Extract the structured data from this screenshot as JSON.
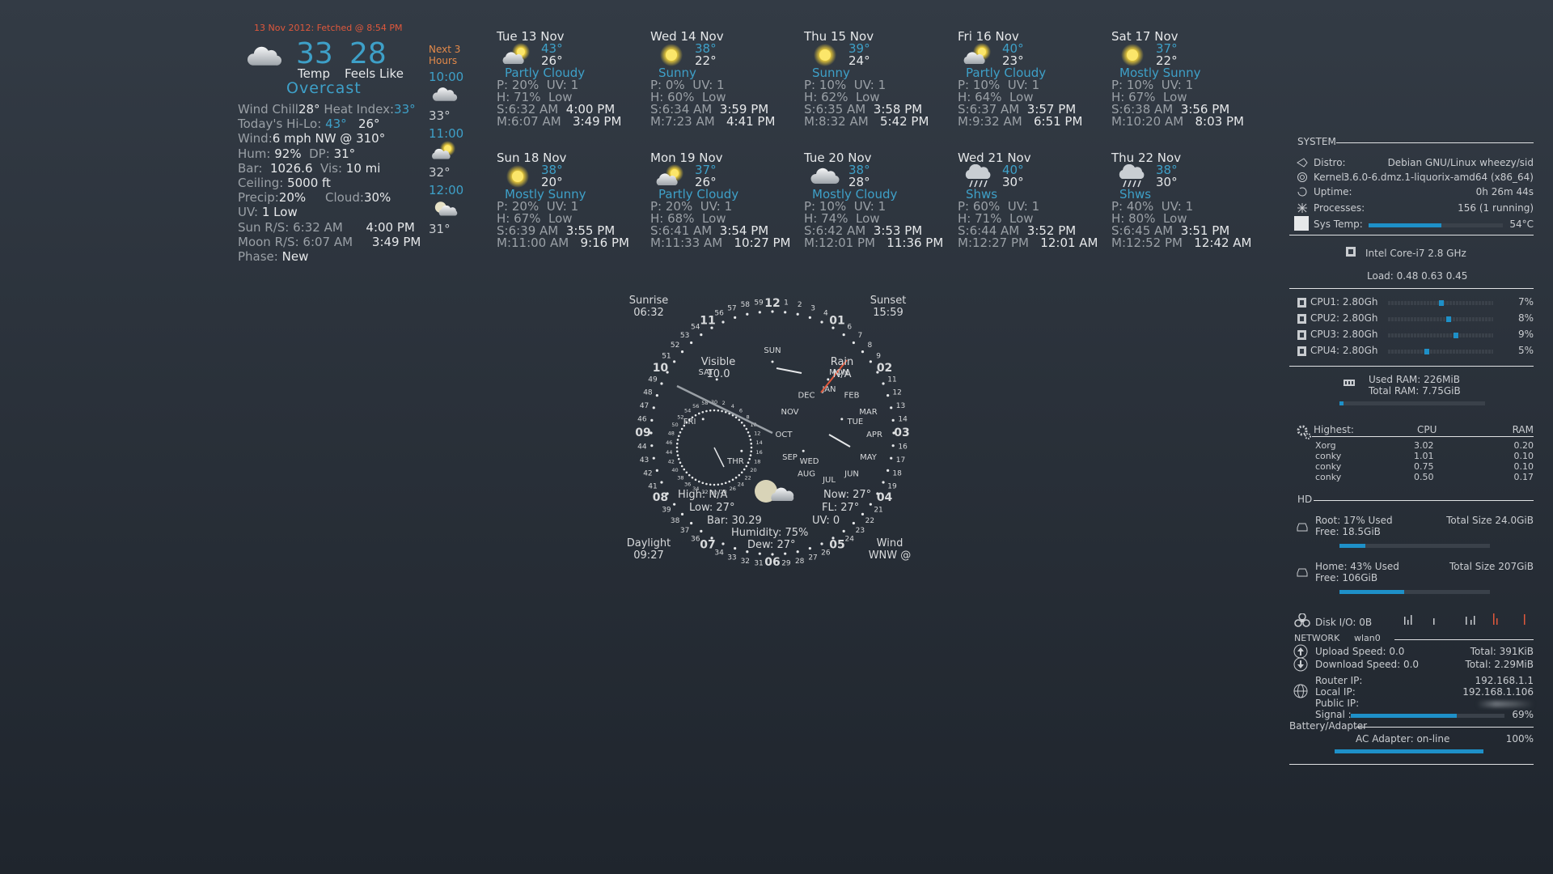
{
  "current": {
    "fetched": "13 Nov 2012: Fetched @ 8:54 PM",
    "temp": "33",
    "feels_like": "28",
    "temp_label": "Temp",
    "feels_label": "Feels Like",
    "condition": "Overcast",
    "wind_chill_label": "Wind Chill",
    "wind_chill": "28°",
    "heat_index_label": "Heat Index:",
    "heat_index": "33°",
    "hilo_label": "Today's Hi-Lo:",
    "hi": "43°",
    "lo": "26°",
    "wind_label": "Wind:",
    "wind": "6 mph   NW   @ 310°",
    "hum_label": "Hum:",
    "hum": "92%",
    "dp_label": "DP:",
    "dp": "31°",
    "bar_label": "Bar:",
    "bar": "1026.6",
    "vis_label": "Vis:",
    "vis": "10 mi",
    "ceiling_label": "Ceiling:",
    "ceiling": "5000 ft",
    "precip_label": "Precip:",
    "precip": "20%",
    "cloud_label": "Cloud:",
    "cloud": "30%",
    "uv_label": "UV:",
    "uv": "1   Low",
    "sun_label": "Sun R/S:",
    "sun_rise": "6:32 AM",
    "sun_set": "4:00 PM",
    "moon_label": "Moon R/S:",
    "moon_rise": "6:07 AM",
    "moon_set": "3:49 PM",
    "phase_label": "Phase:",
    "phase": "New"
  },
  "hourly": {
    "heading_1": "Next 3",
    "heading_2": "Hours",
    "items": [
      {
        "time": "10:00",
        "temp": "33°",
        "icon": "cloud-icon"
      },
      {
        "time": "11:00",
        "temp": "32°",
        "icon": "partly-cloudy-icon"
      },
      {
        "time": "12:00",
        "temp": "31°",
        "icon": "moon-cloud-icon"
      }
    ]
  },
  "forecast": [
    {
      "date": "Tue  13  Nov",
      "hi": "43°",
      "lo": "26°",
      "cond": "Partly Cloudy",
      "icon": "partly-cloudy-icon",
      "p": "P: 20%",
      "uv": "UV: 1",
      "h": "H: 71%",
      "uvl": "Low",
      "s": "S:6:32 AM",
      "sset": "4:00 PM",
      "m": "M:6:07 AM",
      "mset": "3:49 PM"
    },
    {
      "date": "Wed  14  Nov",
      "hi": "38°",
      "lo": "22°",
      "cond": "Sunny",
      "icon": "sun-icon",
      "p": "P: 0%",
      "uv": "UV: 1",
      "h": "H: 60%",
      "uvl": "Low",
      "s": "S:6:34 AM",
      "sset": "3:59 PM",
      "m": "M:7:23 AM",
      "mset": "4:41 PM"
    },
    {
      "date": "Thu  15  Nov",
      "hi": "39°",
      "lo": "24°",
      "cond": "Sunny",
      "icon": "sun-icon",
      "p": "P: 10%",
      "uv": "UV: 1",
      "h": "H: 62%",
      "uvl": "Low",
      "s": "S:6:35 AM",
      "sset": "3:58 PM",
      "m": "M:8:32 AM",
      "mset": "5:42 PM"
    },
    {
      "date": "Fri  16  Nov",
      "hi": "40°",
      "lo": "23°",
      "cond": "Partly Cloudy",
      "icon": "partly-cloudy-icon",
      "p": "P: 10%",
      "uv": "UV: 1",
      "h": "H: 64%",
      "uvl": "Low",
      "s": "S:6:37 AM",
      "sset": "3:57 PM",
      "m": "M:9:32 AM",
      "mset": "6:51 PM"
    },
    {
      "date": "Sat  17  Nov",
      "hi": "37°",
      "lo": "22°",
      "cond": "Mostly Sunny",
      "icon": "sun-icon",
      "p": "P: 10%",
      "uv": "UV: 1",
      "h": "H: 67%",
      "uvl": "Low",
      "s": "S:6:38 AM",
      "sset": "3:56 PM",
      "m": "M:10:20 AM",
      "mset": "8:03 PM"
    },
    {
      "date": "Sun  18  Nov",
      "hi": "38°",
      "lo": "20°",
      "cond": "Mostly Sunny",
      "icon": "sun-icon",
      "p": "P: 20%",
      "uv": "UV: 1",
      "h": "H: 67%",
      "uvl": "Low",
      "s": "S:6:39 AM",
      "sset": "3:55 PM",
      "m": "M:11:00 AM",
      "mset": "9:16 PM"
    },
    {
      "date": "Mon  19  Nov",
      "hi": "37°",
      "lo": "26°",
      "cond": "Partly Cloudy",
      "icon": "partly-cloudy-icon",
      "p": "P: 20%",
      "uv": "UV: 1",
      "h": "H: 68%",
      "uvl": "Low",
      "s": "S:6:41 AM",
      "sset": "3:54 PM",
      "m": "M:11:33 AM",
      "mset": "10:27 PM"
    },
    {
      "date": "Tue  20  Nov",
      "hi": "38°",
      "lo": "28°",
      "cond": "Mostly Cloudy",
      "icon": "cloud-icon",
      "p": "P: 10%",
      "uv": "UV: 1",
      "h": "H: 74%",
      "uvl": "Low",
      "s": "S:6:42 AM",
      "sset": "3:53 PM",
      "m": "M:12:01 PM",
      "mset": "11:36 PM"
    },
    {
      "date": "Wed  21  Nov",
      "hi": "40°",
      "lo": "30°",
      "cond": "Shws",
      "icon": "rain-cloud-icon",
      "p": "P: 60%",
      "uv": "UV: 1",
      "h": "H: 71%",
      "uvl": "Low",
      "s": "S:6:44 AM",
      "sset": "3:52 PM",
      "m": "M:12:27 PM",
      "mset": "12:01 AM"
    },
    {
      "date": "Thu  22  Nov",
      "hi": "38°",
      "lo": "30°",
      "cond": "Shws",
      "icon": "rain-cloud-icon",
      "p": "P: 40%",
      "uv": "UV: 1",
      "h": "H: 80%",
      "uvl": "Low",
      "s": "S:6:45 AM",
      "sset": "3:51 PM",
      "m": "M:12:52 PM",
      "mset": "12:42 AM"
    }
  ],
  "clock": {
    "sunrise_label": "Sunrise",
    "sunrise": "06:32",
    "sunset_label": "Sunset",
    "sunset": "15:59",
    "daylight_label": "Daylight",
    "daylight": "09:27",
    "wind_label": "Wind",
    "wind": "WNW @",
    "visible_label": "Visible",
    "visible": "10.0",
    "rain_label": "Rain",
    "rain": "N/A",
    "high": "High: N/A",
    "low": "Low: 27°",
    "bar": "Bar: 30.29",
    "humidity": "Humidity: 75%",
    "dew": "Dew: 27°",
    "now": "Now: 27°",
    "fl": "FL: 27°",
    "uv": "UV: 0",
    "hours": [
      "12",
      "01",
      "02",
      "03",
      "04",
      "05",
      "06",
      "07",
      "08",
      "09",
      "10",
      "11"
    ],
    "days": [
      "SUN",
      "MON",
      "TUE",
      "WED",
      "THR",
      "FRI",
      "SAT"
    ],
    "months": [
      "JAN",
      "FEB",
      "MAR",
      "APR",
      "MAY",
      "JUN",
      "JUL",
      "AUG",
      "SEP",
      "OCT",
      "NOV",
      "DEC"
    ]
  },
  "system": {
    "header": "SYSTEM",
    "distro_label": "Distro:",
    "distro": "Debian GNU/Linux wheezy/sid",
    "kernel_label": "Kernel:",
    "kernel": "3.6.0-6.dmz.1-liquorix-amd64 (x86_64)",
    "uptime_label": "Uptime:",
    "uptime": "0h 26m 44s",
    "processes_label": "Processes:",
    "processes": "156 (1 running)",
    "systemp_label": "Sys Temp:",
    "systemp": "54°C",
    "systemp_fraction": 0.54,
    "cpu_name": "Intel Core-i7 2.8 GHz",
    "load": "Load:  0.48 0.63 0.45",
    "cpus": [
      {
        "label": "CPU1: 2.80Gh",
        "pct": "7%",
        "value": 7
      },
      {
        "label": "CPU2: 2.80Gh",
        "pct": "8%",
        "value": 8
      },
      {
        "label": "CPU3: 2.80Gh",
        "pct": "9%",
        "value": 9
      },
      {
        "label": "CPU4: 2.80Gh",
        "pct": "5%",
        "value": 5
      }
    ],
    "ram_used": "Used RAM: 226MiB",
    "ram_total": "Total RAM: 7.75GiB",
    "ram_fraction": 0.03,
    "highest_label": "Highest:",
    "cpu_col": "CPU",
    "ram_col": "RAM",
    "procs": [
      {
        "name": "Xorg",
        "cpu": "3.02",
        "ram": "0.20"
      },
      {
        "name": "conky",
        "cpu": "1.01",
        "ram": "0.10"
      },
      {
        "name": "conky",
        "cpu": "0.75",
        "ram": "0.10"
      },
      {
        "name": "conky",
        "cpu": "0.50",
        "ram": "0.17"
      }
    ],
    "hd_header": "HD",
    "root_used": "Root: 17% Used",
    "root_free": "Free: 18.5GiB",
    "root_total": "Total Size 24.0GiB",
    "root_fraction": 0.17,
    "home_used": "Home: 43% Used",
    "home_free": "Free: 106GiB",
    "home_total": "Total Size 207GiB",
    "home_fraction": 0.43,
    "diskio": "Disk I/O: 0B",
    "network_label": "NETWORK",
    "iface": "wlan0",
    "upload": "Upload Speed: 0.0",
    "upload_total": "Total: 391KiB",
    "download": "Download Speed: 0.0",
    "download_total": "Total: 2.29MiB",
    "router_label": "Router IP:",
    "router": "192.168.1.1",
    "local_label": "Local IP:",
    "local": "192.168.1.106",
    "public_label": "Public IP:",
    "signal_label": "Signal :",
    "signal": "69%",
    "signal_fraction": 0.69,
    "battery_label": "Battery/Adapter",
    "adapter": "AC Adapter: on-line",
    "adapter_pct": "100%",
    "adapter_fraction": 1.0
  },
  "colors": {
    "accent": "#3ea0c8",
    "fetched": "#e0583c",
    "bar_fill": "#1e90c8"
  }
}
